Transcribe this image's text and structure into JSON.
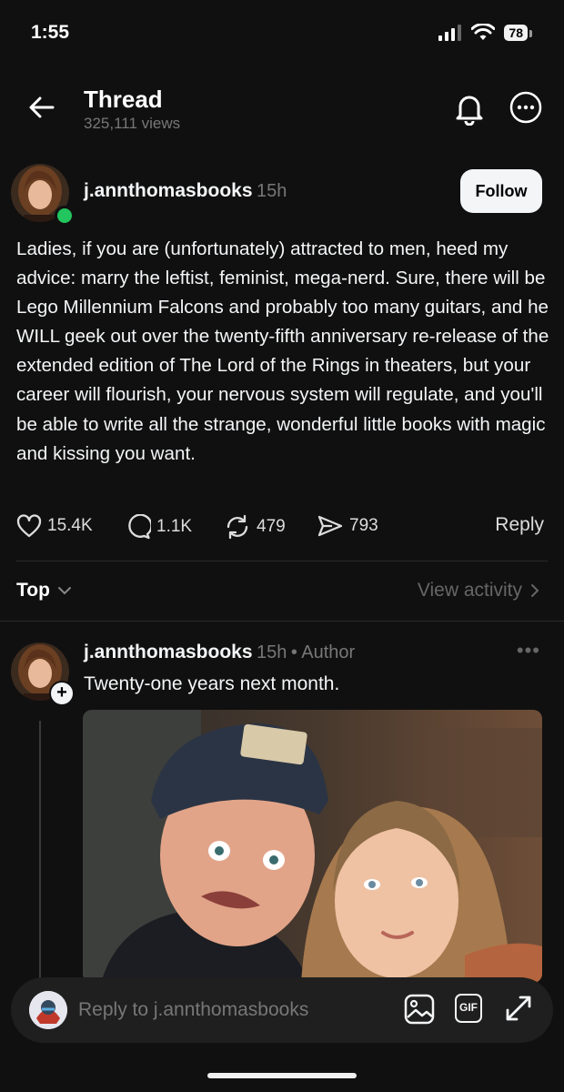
{
  "status": {
    "time": "1:55",
    "battery": "78"
  },
  "header": {
    "title": "Thread",
    "views": "325,111 views"
  },
  "post": {
    "username": "j.annthomasbooks",
    "time": "15h",
    "follow_label": "Follow",
    "text": "Ladies, if you are (unfortunately) attracted to men, heed my advice: marry the leftist, feminist, mega-nerd. Sure, there will be Lego Millennium Falcons and probably too many guitars, and he WILL geek out over the twenty-fifth anniversary re-release of the extended edition of The Lord of the Rings in theaters, but your career will flourish, your nervous system will regulate, and you'll be able to write all the strange, wonderful little books with magic and kissing you want.",
    "likes": "15.4K",
    "comments": "1.1K",
    "reposts": "479",
    "shares": "793",
    "reply_label": "Reply"
  },
  "sort": {
    "label": "Top",
    "view_activity": "View activity"
  },
  "reply": {
    "username": "j.annthomasbooks",
    "time": "15h",
    "separator": "•",
    "badge": "Author",
    "text": "Twenty-one years next month.",
    "more": "•••"
  },
  "composer": {
    "placeholder": "Reply to j.annthomasbooks",
    "gif_label": "GIF"
  },
  "colors": {
    "background": "#101010",
    "online": "#22c55e",
    "muted": "#777777"
  }
}
